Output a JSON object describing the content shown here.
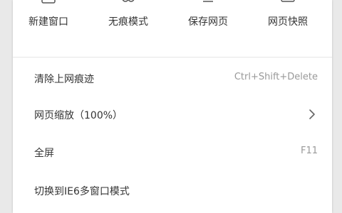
{
  "top_actions": [
    {
      "label": "新建窗口",
      "icon": "new-window-icon"
    },
    {
      "label": "无痕模式",
      "icon": "incognito-icon"
    },
    {
      "label": "保存网页",
      "icon": "save-page-icon"
    },
    {
      "label": "网页快照",
      "icon": "snapshot-icon"
    }
  ],
  "items": [
    {
      "label": "清除上网痕迹",
      "shortcut": "Ctrl+Shift+Delete"
    },
    {
      "label": "网页缩放（100%）",
      "icon": "chevron-right-icon"
    },
    {
      "label": "全屏",
      "shortcut": "F11"
    },
    {
      "label": "切换到IE6多窗口模式"
    }
  ],
  "colors": {
    "text": "#333333",
    "shortcut": "#999999",
    "separator": "#e6e6e6",
    "background": "#e9e9e9",
    "panel": "#ffffff"
  }
}
